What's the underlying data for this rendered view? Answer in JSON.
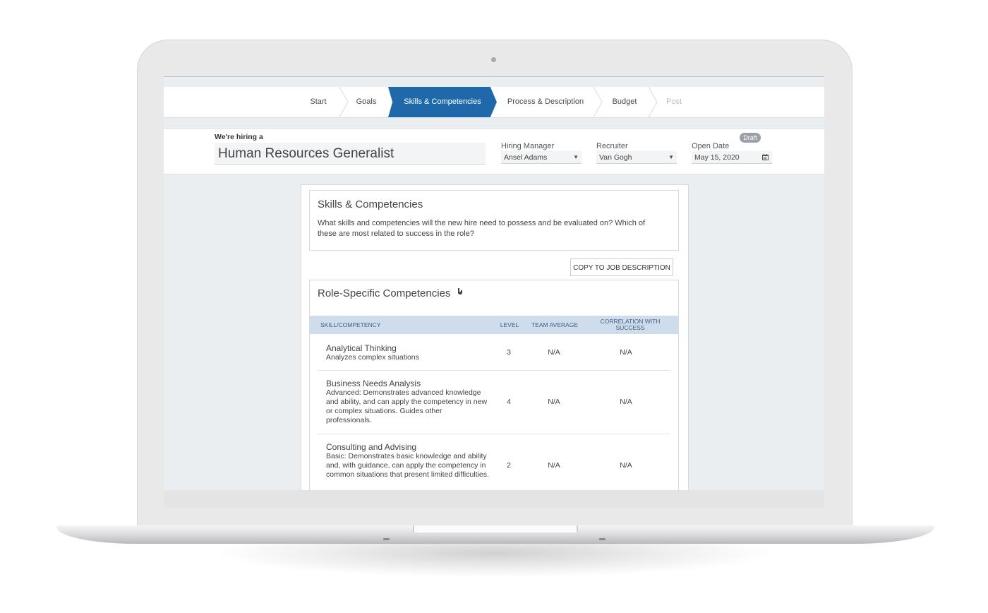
{
  "steps": [
    {
      "label": "Start",
      "state": "done"
    },
    {
      "label": "Goals",
      "state": "done"
    },
    {
      "label": "Skills & Competencies",
      "state": "active"
    },
    {
      "label": "Process & Description",
      "state": "upcoming"
    },
    {
      "label": "Budget",
      "state": "upcoming"
    },
    {
      "label": "Post",
      "state": "disabled"
    }
  ],
  "header": {
    "hiring_label": "We're hiring a",
    "job_title": "Human Resources Generalist",
    "hiring_manager_label": "Hiring Manager",
    "hiring_manager_value": "Ansel Adams",
    "recruiter_label": "Recruiter",
    "recruiter_value": "Van Gogh",
    "open_date_label": "Open Date",
    "open_date_value": "May 15, 2020",
    "status_badge": "Draft"
  },
  "intro": {
    "title": "Skills & Competencies",
    "text": "What skills and competencies will the new hire need to possess and be evaluated on? Which of these are most related to success in the role?"
  },
  "copy_button": "COPY TO JOB DESCRIPTION",
  "competencies": {
    "title": "Role-Specific Competencies",
    "columns": [
      "SKILL/COMPETENCY",
      "LEVEL",
      "TEAM AVERAGE",
      "CORRELATION WITH SUCCESS"
    ],
    "rows": [
      {
        "name": "Analytical Thinking",
        "desc": "Analyzes complex situations",
        "level": "3",
        "team_avg": "N/A",
        "correlation": "N/A"
      },
      {
        "name": "Business Needs Analysis",
        "desc": "Advanced: Demonstrates advanced knowledge and ability, and can apply the competency in new or complex situations. Guides other professionals.",
        "level": "4",
        "team_avg": "N/A",
        "correlation": "N/A"
      },
      {
        "name": "Consulting and Advising",
        "desc": "Basic: Demonstrates basic knowledge and ability and, with guidance, can apply the competency in common situations that present limited difficulties.",
        "level": "2",
        "team_avg": "N/A",
        "correlation": "N/A"
      }
    ]
  },
  "icons": {
    "caret": "chevron-down-icon",
    "calendar": "calendar-icon",
    "info": "info-icon"
  },
  "colors": {
    "accent": "#1f69aa",
    "table_header_bg": "#cfdceb",
    "screen_bg": "#eaeef1"
  }
}
